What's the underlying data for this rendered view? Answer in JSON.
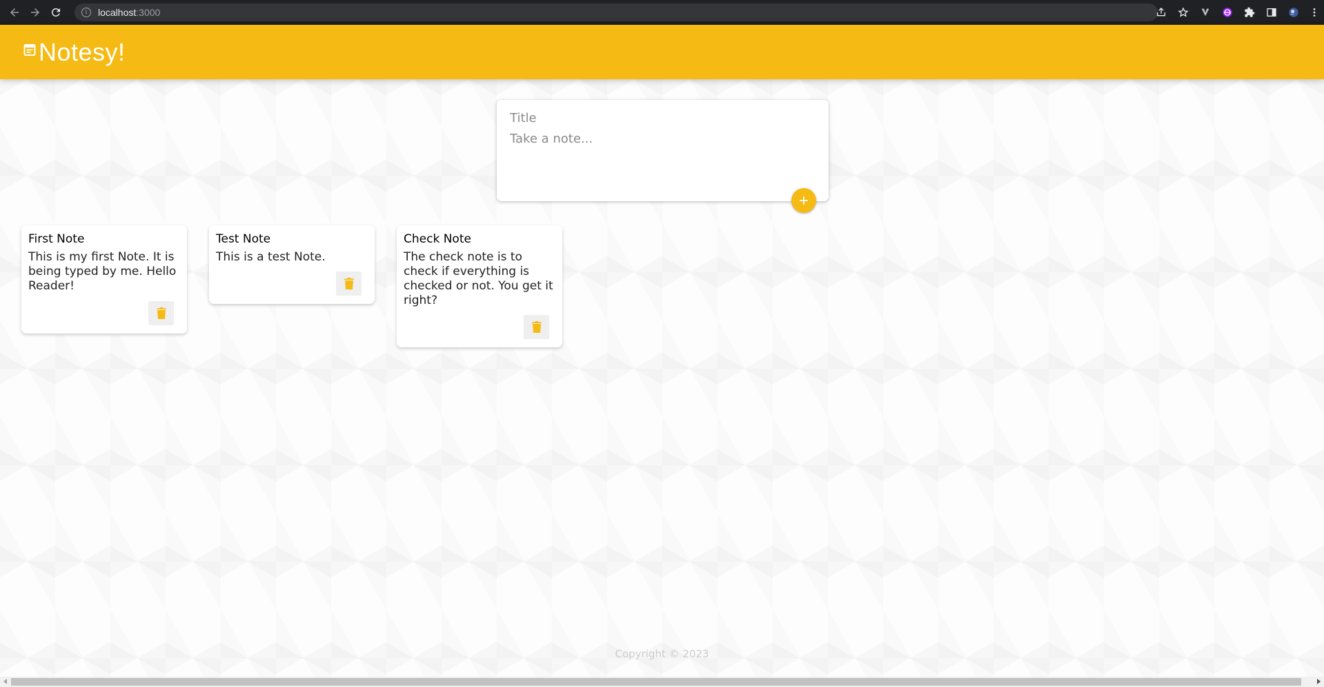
{
  "browser": {
    "url_host": "localhost",
    "url_port": ":3000"
  },
  "header": {
    "brand": "Notesy!",
    "accent_color": "#f5ba13"
  },
  "compose": {
    "title_placeholder": "Title",
    "content_placeholder": "Take a note..."
  },
  "notes": [
    {
      "title": "First Note",
      "content": "This is my first Note. It is being typed by me. Hello Reader!"
    },
    {
      "title": "Test Note",
      "content": "This is a test Note."
    },
    {
      "title": "Check Note",
      "content": "The check note is to check if everything is checked or not. You get it right?"
    }
  ],
  "footer": {
    "copyright": "Copyright © 2023"
  }
}
